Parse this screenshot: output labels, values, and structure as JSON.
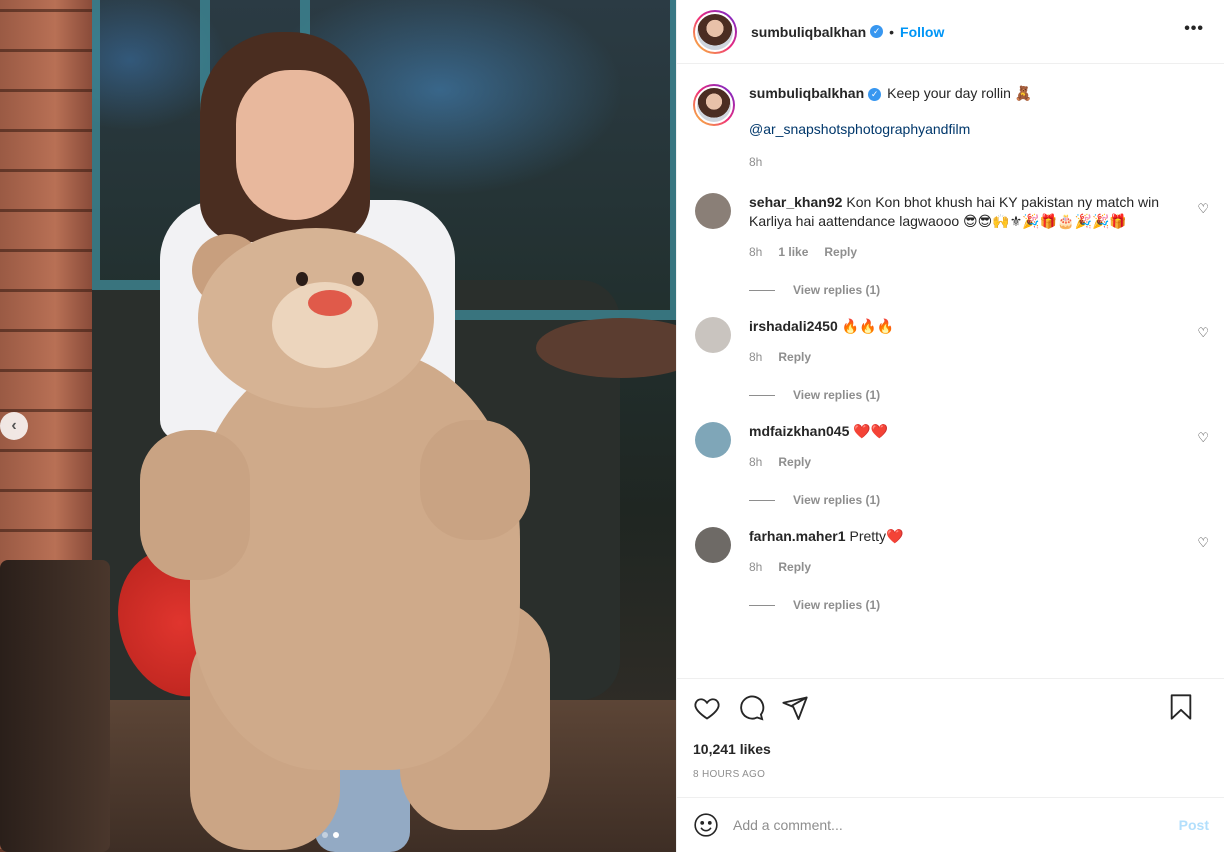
{
  "post": {
    "photo_alt": "",
    "carousel": {
      "slides": 2,
      "active": 2
    }
  },
  "header": {
    "username": "sumbuliqbalkhan",
    "bullet": "•",
    "follow_label": "Follow",
    "more_label": "•••",
    "verified_glyph": "✓"
  },
  "caption": {
    "username": "sumbuliqbalkhan",
    "text": "Keep your day rollin 🧸",
    "mention": "@ar_snapshotsphotographyandfilm",
    "time": "8h"
  },
  "comments": [
    {
      "username": "sehar_khan92",
      "text": "Kon Kon bhot khush hai KY pakistan ny match win Karliya hai aattendance lagwaooo 😎😎🙌⚜🎉🎁🎂🎉🎉🎁",
      "time": "8h",
      "likes": "1 like",
      "reply": "Reply",
      "view_replies": "View replies (1)",
      "avatar_color": "#8a7f77"
    },
    {
      "username": "irshadali2450",
      "text": "🔥🔥🔥",
      "time": "8h",
      "likes": "",
      "reply": "Reply",
      "view_replies": "View replies (1)",
      "avatar_color": "#c9c4bf"
    },
    {
      "username": "mdfaizkhan045",
      "text": "❤️❤️",
      "time": "8h",
      "likes": "",
      "reply": "Reply",
      "view_replies": "View replies (1)",
      "avatar_color": "#7fa6b8"
    },
    {
      "username": "farhan.maher1",
      "text": "Pretty❤️",
      "time": "8h",
      "likes": "",
      "reply": "Reply",
      "view_replies": "View replies (1)",
      "avatar_color": "#6e6a66"
    }
  ],
  "actions": {
    "likes": "10,241 likes",
    "time": "8 HOURS AGO"
  },
  "add_comment": {
    "placeholder": "Add a comment...",
    "post_label": "Post",
    "emoji_glyph": "☺"
  },
  "colors": {
    "accent": "#0095f6",
    "verified": "#3897f0",
    "muted": "#8e8e8e",
    "post_disabled": "#b2dffc"
  }
}
